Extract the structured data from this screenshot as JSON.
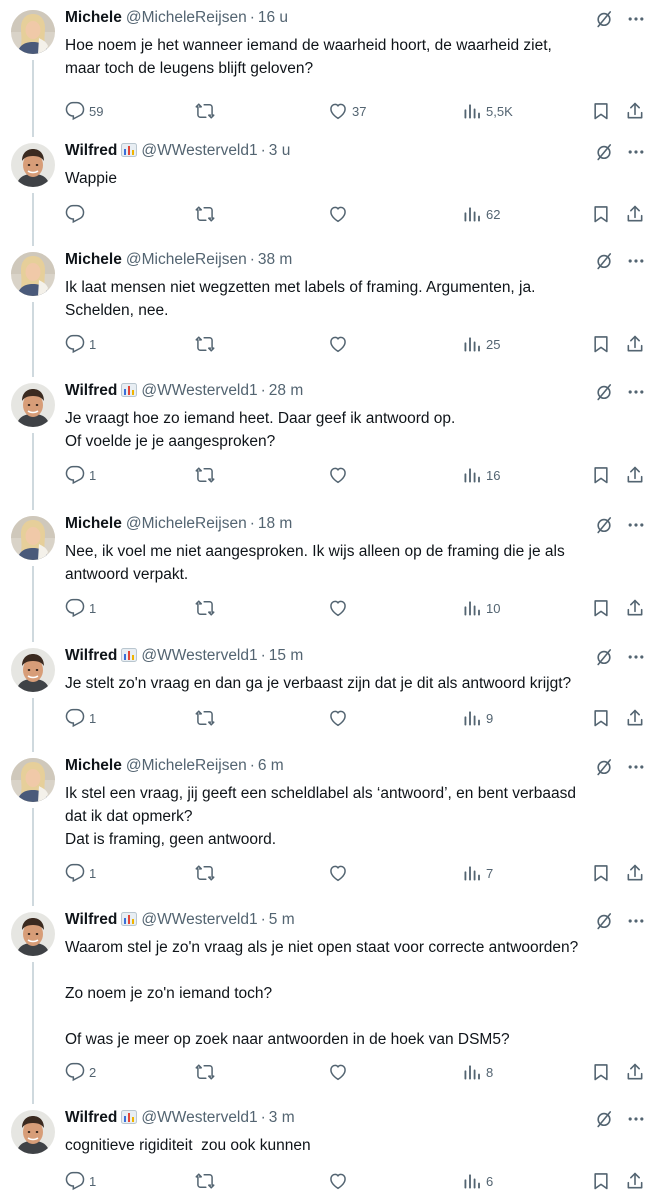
{
  "tweets": [
    {
      "name": "Michele",
      "handle": "@MicheleReijsen",
      "time": "16 u",
      "text": "Hoe noem je het wanneer iemand de waarheid hoort, de waarheid ziet,\nmaar toch de leugens blijft geloven?",
      "replies": "59",
      "reposts": "",
      "likes": "37",
      "views": "5,5K",
      "badge": false,
      "avatar": "michele"
    },
    {
      "name": "Wilfred",
      "handle": "@WWesterveld1",
      "time": "3 u",
      "text": "Wappie",
      "replies": "",
      "reposts": "",
      "likes": "",
      "views": "62",
      "badge": true,
      "avatar": "wilfred"
    },
    {
      "name": "Michele",
      "handle": "@MicheleReijsen",
      "time": "38 m",
      "text": "Ik laat mensen niet wegzetten met labels of framing. Argumenten, ja.\nSchelden, nee.",
      "replies": "1",
      "reposts": "",
      "likes": "",
      "views": "25",
      "badge": false,
      "avatar": "michele"
    },
    {
      "name": "Wilfred",
      "handle": "@WWesterveld1",
      "time": "28 m",
      "text": "Je vraagt hoe zo iemand heet. Daar geef ik antwoord op.\nOf voelde je je aangesproken?",
      "replies": "1",
      "reposts": "",
      "likes": "",
      "views": "16",
      "badge": true,
      "avatar": "wilfred"
    },
    {
      "name": "Michele",
      "handle": "@MicheleReijsen",
      "time": "18 m",
      "text": "Nee, ik voel me niet aangesproken. Ik wijs alleen op de framing die je als\nantwoord verpakt.",
      "replies": "1",
      "reposts": "",
      "likes": "",
      "views": "10",
      "badge": false,
      "avatar": "michele"
    },
    {
      "name": "Wilfred",
      "handle": "@WWesterveld1",
      "time": "15 m",
      "text": "Je stelt zo'n vraag en dan ga je verbaast zijn dat je dit als antwoord krijgt?",
      "replies": "1",
      "reposts": "",
      "likes": "",
      "views": "9",
      "badge": true,
      "avatar": "wilfred"
    },
    {
      "name": "Michele",
      "handle": "@MicheleReijsen",
      "time": "6 m",
      "text": "Ik stel een vraag, jij geeft een scheldlabel als ‘antwoord’, en bent verbaasd\ndat ik dat opmerk?\nDat is framing, geen antwoord.",
      "replies": "1",
      "reposts": "",
      "likes": "",
      "views": "7",
      "badge": false,
      "avatar": "michele"
    },
    {
      "name": "Wilfred",
      "handle": "@WWesterveld1",
      "time": "5 m",
      "text": "Waarom stel je zo'n vraag als je niet open staat voor correcte antwoorden?\n\nZo noem je zo'n iemand toch?\n\nOf was je meer op zoek naar antwoorden in de hoek van DSM5?",
      "replies": "2",
      "reposts": "",
      "likes": "",
      "views": "8",
      "badge": true,
      "avatar": "wilfred"
    },
    {
      "name": "Wilfred",
      "handle": "@WWesterveld1",
      "time": "3 m",
      "text": "cognitieve rigiditeit  zou ook kunnen",
      "replies": "1",
      "reposts": "",
      "likes": "",
      "views": "6",
      "badge": true,
      "avatar": "wilfred"
    }
  ],
  "icons": {
    "reply": "reply-icon",
    "repost": "repost-icon",
    "like": "like-icon",
    "views": "views-icon",
    "bookmark": "bookmark-icon",
    "share": "share-icon",
    "hide": "hide-reply-icon",
    "more": "more-icon",
    "badge": "bar-chart-badge-icon"
  },
  "colors": {
    "text": "#0f1419",
    "muted": "#536471",
    "line": "#cfd9de"
  }
}
